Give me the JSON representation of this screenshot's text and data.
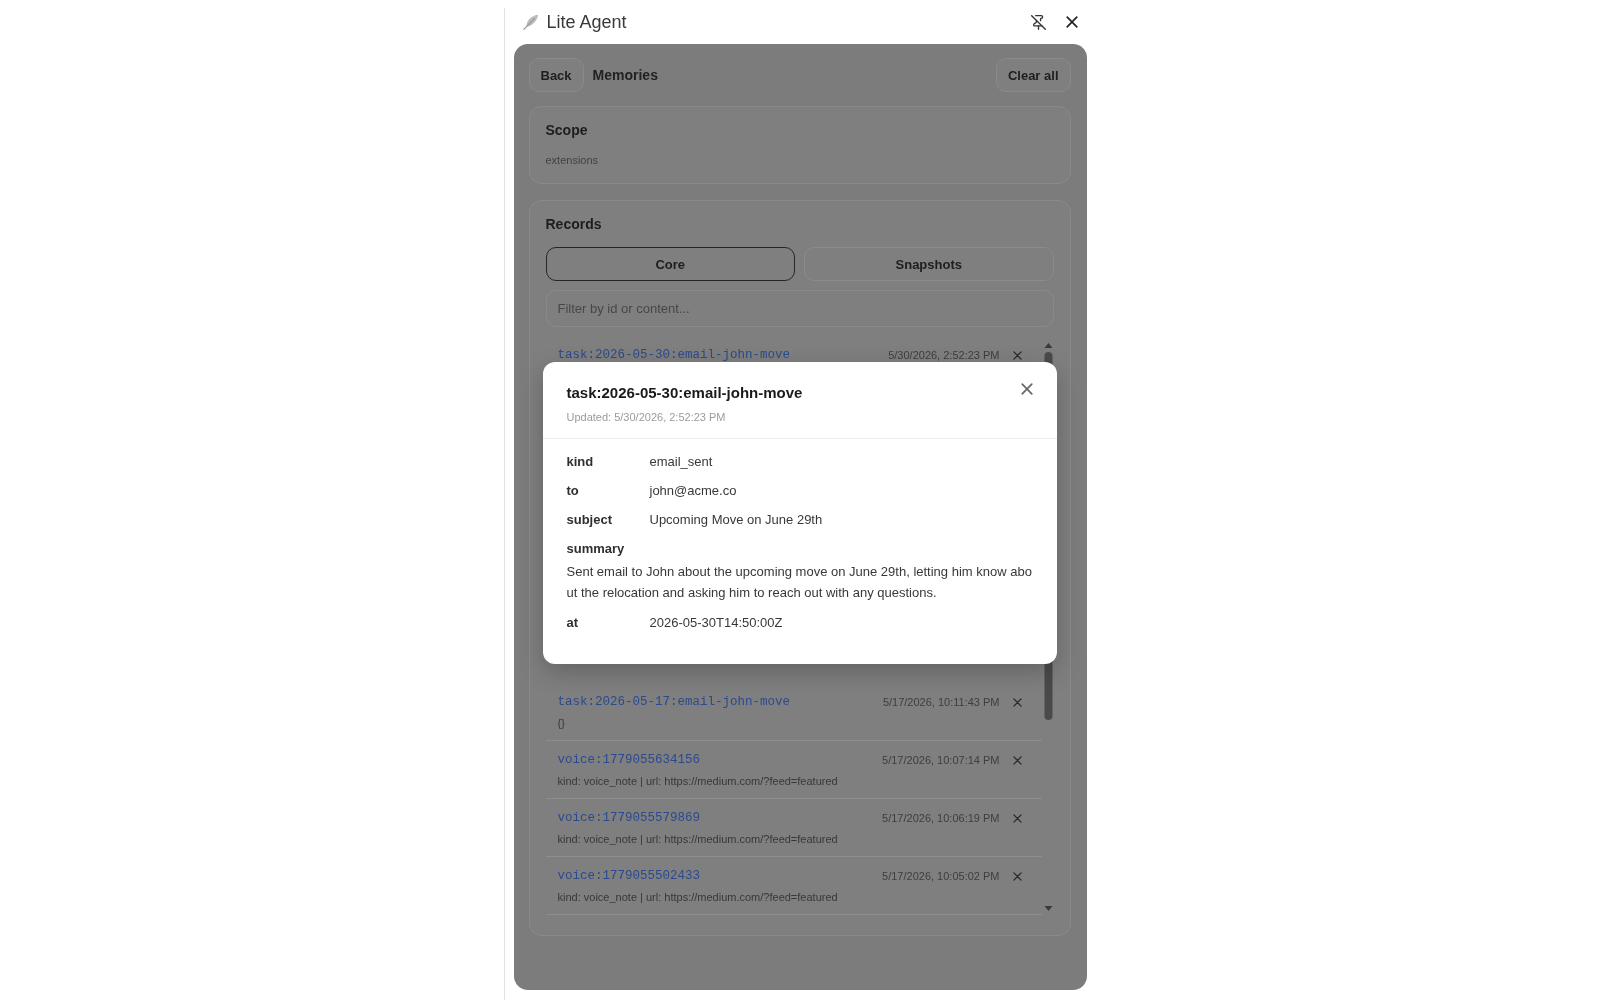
{
  "window": {
    "title": "Lite Agent"
  },
  "header": {
    "back": "Back",
    "title": "Memories",
    "clear": "Clear all"
  },
  "scope": {
    "heading": "Scope",
    "value": "extensions"
  },
  "records": {
    "heading": "Records",
    "tabs": [
      {
        "label": "Core",
        "selected": true
      },
      {
        "label": "Snapshots",
        "selected": false
      }
    ],
    "filter": {
      "placeholder": "Filter by id or content..."
    },
    "items": [
      {
        "id": "task:2026-05-30:email-john-move",
        "time": "5/30/2026, 2:52:23 PM"
      },
      {
        "id": "task:2026-05-17:email-john-move",
        "time": "5/17/2026, 10:11:43 PM",
        "summary": "{}"
      },
      {
        "id": "voice:1779055634156",
        "time": "5/17/2026, 10:07:14 PM",
        "summary": "kind: voice_note | url: https://medium.com/?feed=featured"
      },
      {
        "id": "voice:1779055579869",
        "time": "5/17/2026, 10:06:19 PM",
        "summary": "kind: voice_note | url: https://medium.com/?feed=featured"
      },
      {
        "id": "voice:1779055502433",
        "time": "5/17/2026, 10:05:02 PM",
        "summary": "kind: voice_note | url: https://medium.com/?feed=featured"
      }
    ]
  },
  "dialog": {
    "title": "task:2026-05-30:email-john-move",
    "updated": "Updated: 5/30/2026, 2:52:23 PM",
    "fields": [
      {
        "kind": "inline",
        "label": "kind",
        "value": "email_sent"
      },
      {
        "kind": "inline",
        "label": "to",
        "value": "john@acme.co"
      },
      {
        "kind": "inline",
        "label": "subject",
        "value": "Upcoming Move on June 29th"
      },
      {
        "kind": "block",
        "label": "summary",
        "value": "Sent email to John about the upcoming move on June 29th, letting him know about the relocation and asking him to reach out with any questions."
      },
      {
        "kind": "inline",
        "label": "at",
        "value": "2026-05-30T14:50:00Z"
      }
    ]
  }
}
